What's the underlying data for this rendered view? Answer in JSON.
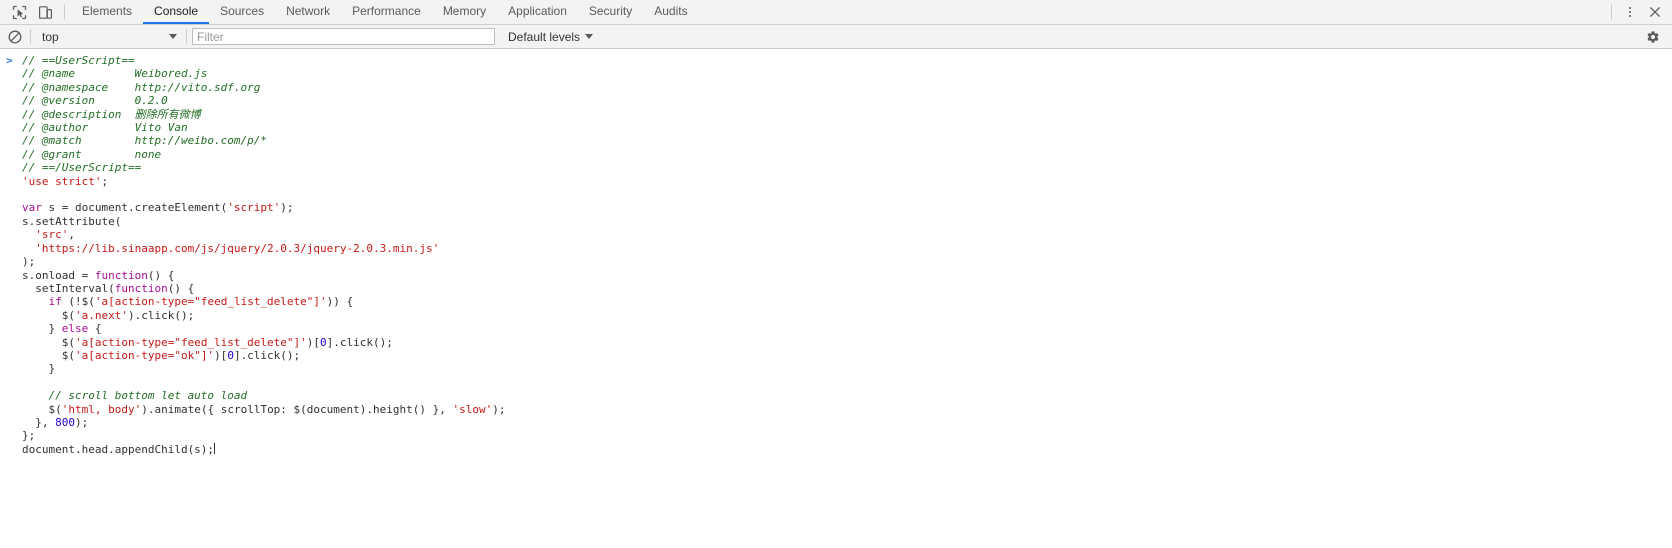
{
  "window": {
    "title": "DevTools Console"
  },
  "tabbar": {
    "inspect_icon": "inspect-element-icon",
    "device_icon": "device-toolbar-icon",
    "tabs": [
      {
        "label": "Elements",
        "active": false
      },
      {
        "label": "Console",
        "active": true
      },
      {
        "label": "Sources",
        "active": false
      },
      {
        "label": "Network",
        "active": false
      },
      {
        "label": "Performance",
        "active": false
      },
      {
        "label": "Memory",
        "active": false
      },
      {
        "label": "Application",
        "active": false
      },
      {
        "label": "Security",
        "active": false
      },
      {
        "label": "Audits",
        "active": false
      }
    ],
    "more_icon": "vertical-dots-icon",
    "close_icon": "close-icon"
  },
  "toolbar": {
    "clear_icon": "clear-console-icon",
    "context": "top",
    "context_caret_icon": "chevron-down-icon",
    "filter_placeholder": "Filter",
    "filter_value": "",
    "levels_label": "Default levels",
    "levels_caret_icon": "chevron-down-icon",
    "settings_icon": "gear-icon"
  },
  "console": {
    "prompt_symbol": ">",
    "accent_color": "#1a73e8",
    "comment_color": "#236e25",
    "string_color": "#c41a16",
    "keyword_color": "#aa0d91",
    "number_color": "#1c00cf",
    "code_lines": [
      {
        "type": "comment",
        "text": "// ==UserScript=="
      },
      {
        "type": "comment",
        "text": "// @name         Weibored.js"
      },
      {
        "type": "comment",
        "text": "// @namespace    http://vito.sdf.org"
      },
      {
        "type": "comment",
        "text": "// @version      0.2.0"
      },
      {
        "type": "comment",
        "text": "// @description  删除所有微博"
      },
      {
        "type": "comment",
        "text": "// @author       Vito Van"
      },
      {
        "type": "comment",
        "text": "// @match        http://weibo.com/p/*"
      },
      {
        "type": "comment",
        "text": "// @grant        none"
      },
      {
        "type": "comment",
        "text": "// ==/UserScript=="
      },
      {
        "type": "code",
        "text": "'use strict';"
      },
      {
        "type": "blank",
        "text": ""
      },
      {
        "type": "code",
        "text": "var s = document.createElement('script');"
      },
      {
        "type": "code",
        "text": "s.setAttribute("
      },
      {
        "type": "code",
        "text": "  'src',"
      },
      {
        "type": "code",
        "text": "  'https://lib.sinaapp.com/js/jquery/2.0.3/jquery-2.0.3.min.js'"
      },
      {
        "type": "code",
        "text": ");"
      },
      {
        "type": "code",
        "text": "s.onload = function() {"
      },
      {
        "type": "code",
        "text": "  setInterval(function() {"
      },
      {
        "type": "code",
        "text": "    if (!$('a[action-type=\"feed_list_delete\"]')) {"
      },
      {
        "type": "code",
        "text": "      $('a.next').click();"
      },
      {
        "type": "code",
        "text": "    } else {"
      },
      {
        "type": "code",
        "text": "      $('a[action-type=\"feed_list_delete\"]')[0].click();"
      },
      {
        "type": "code",
        "text": "      $('a[action-type=\"ok\"]')[0].click();"
      },
      {
        "type": "code",
        "text": "    }"
      },
      {
        "type": "blank",
        "text": ""
      },
      {
        "type": "comment",
        "text": "    // scroll bottom let auto load"
      },
      {
        "type": "code",
        "text": "    $('html, body').animate({ scrollTop: $(document).height() }, 'slow');"
      },
      {
        "type": "code",
        "text": "  }, 800);"
      },
      {
        "type": "code",
        "text": "};"
      },
      {
        "type": "code",
        "text": "document.head.appendChild(s);"
      }
    ]
  }
}
